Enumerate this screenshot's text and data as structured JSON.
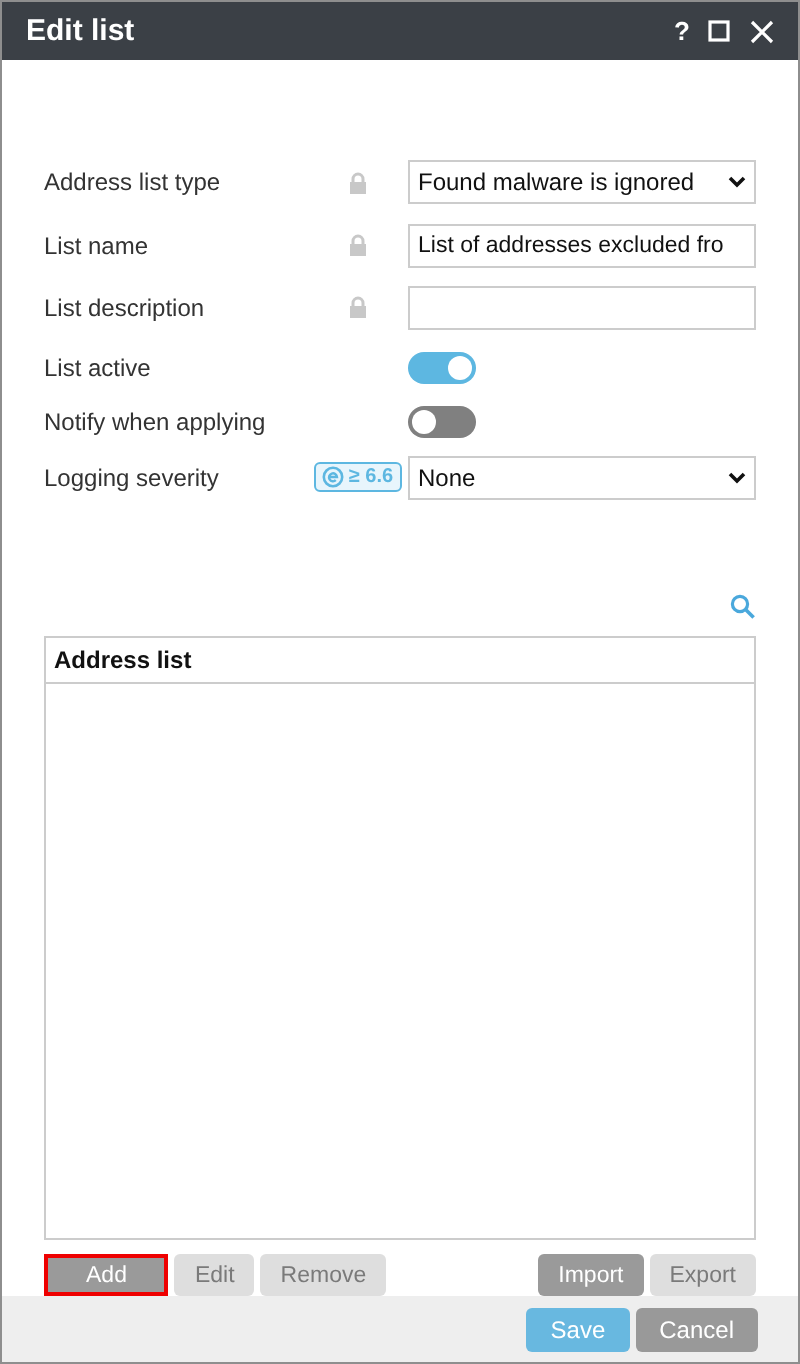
{
  "window": {
    "title": "Edit list",
    "controls": [
      "?"
    ]
  },
  "fields": [
    {
      "kind": "select",
      "label": "Address list type",
      "locked": true,
      "value": "Found malware is ignored"
    },
    {
      "kind": "text",
      "label": "List name",
      "locked": true,
      "value": "List of addresses excluded fro"
    },
    {
      "kind": "text",
      "label": "List description",
      "locked": true
    },
    {
      "kind": "toggle",
      "label": "List active",
      "on": true
    },
    {
      "kind": "toggle",
      "label": "Notify when applying",
      "on": false
    },
    {
      "kind": "select",
      "label": "Logging severity",
      "locked": false,
      "badge": "≥ 6.6",
      "value": "None"
    }
  ],
  "table": {
    "columns": [
      "Address list"
    ]
  },
  "list_buttons": [
    {
      "label": "Add",
      "disabled": false,
      "highlighted": true
    },
    {
      "label": "Edit",
      "disabled": true,
      "highlighted": false
    },
    {
      "label": "Remove",
      "disabled": true,
      "highlighted": false
    }
  ],
  "transfer_buttons": [
    {
      "label": "Import",
      "disabled": false,
      "highlighted": false
    },
    {
      "label": "Export",
      "disabled": true,
      "highlighted": false
    }
  ],
  "footer_buttons": [
    {
      "label": "Save",
      "kind": "primary"
    },
    {
      "label": "Cancel",
      "kind": "secondary"
    }
  ]
}
